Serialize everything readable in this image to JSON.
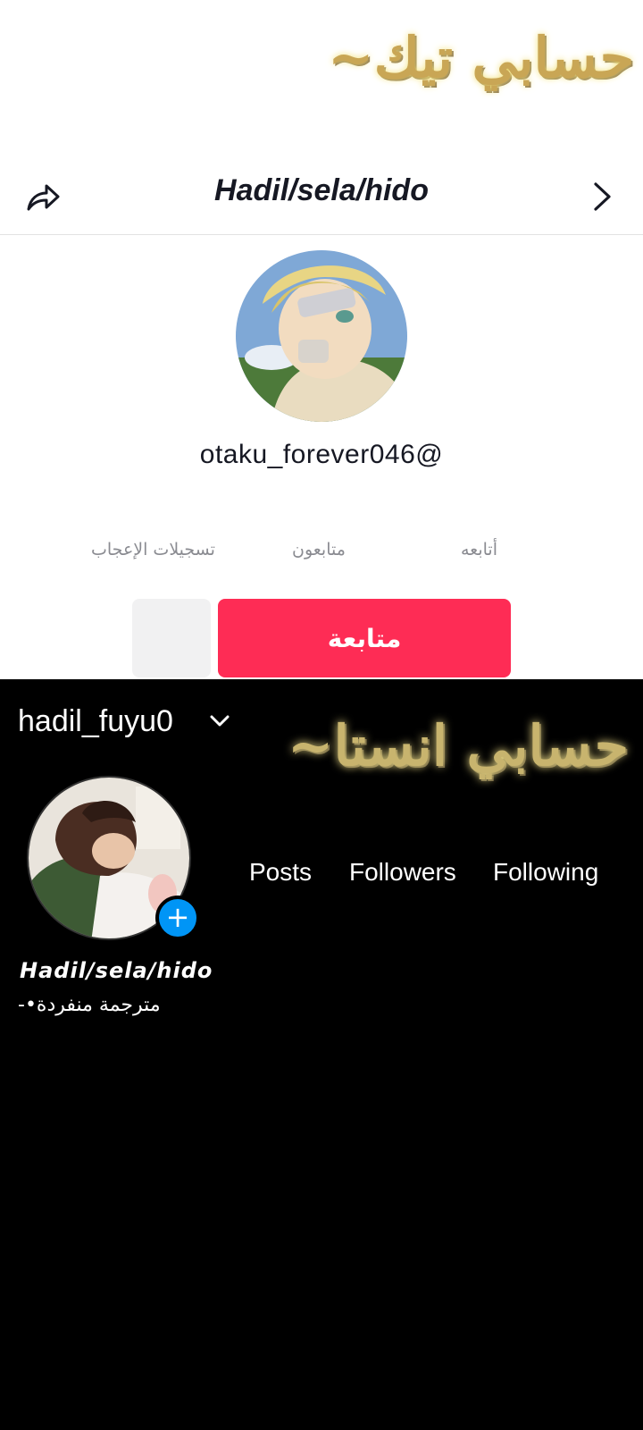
{
  "tiktok": {
    "overlay_title": "حسابي تيك~",
    "header": {
      "title": "Hadil/sela/hido",
      "share_icon": "share-arrow-icon",
      "chevron_icon": "chevron-right-icon"
    },
    "handle": "otaku_forever046@",
    "stats": {
      "following": "أتابعه",
      "followers": "متابعون",
      "likes": "تسجيلات الإعجاب"
    },
    "follow_button": "متابعة",
    "accent": "#fe2c55"
  },
  "instagram": {
    "username": "hadil_fuyu0",
    "overlay_title": "حسابي انستا~",
    "stats": {
      "posts": "Posts",
      "followers": "Followers",
      "following": "Following"
    },
    "display_name": "Hadil/sela/hido",
    "bio": "مترجمة منفردة•-",
    "add_icon": "plus-icon",
    "accent": "#0095f6"
  }
}
